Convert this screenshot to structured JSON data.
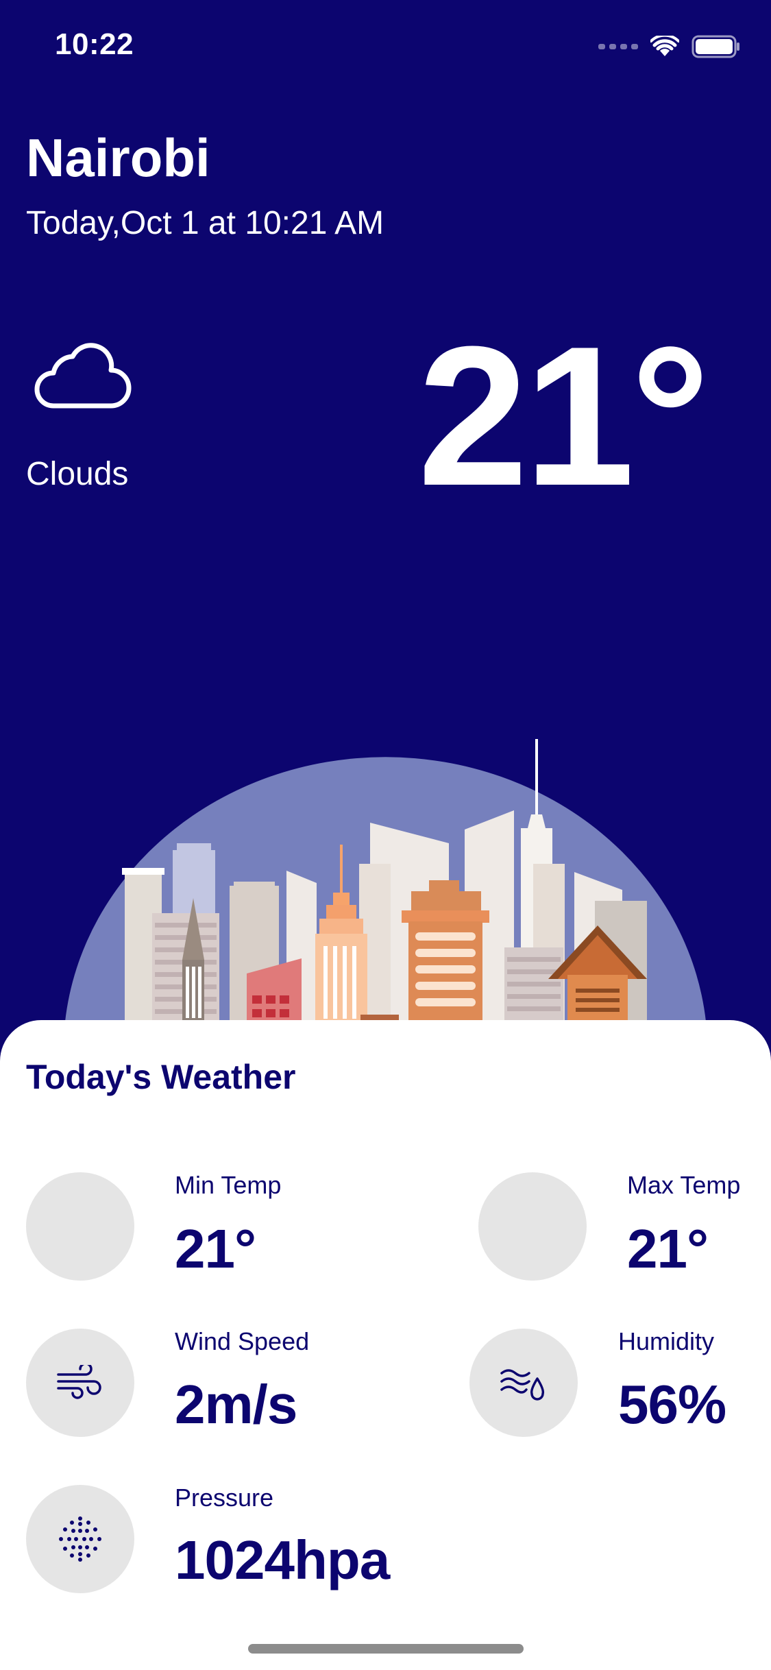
{
  "status_bar": {
    "time": "10:22",
    "wifi_icon": "wifi-icon",
    "battery_icon": "battery-icon"
  },
  "header": {
    "city": "Nairobi",
    "datetime": "Today,Oct 1 at 10:21 AM"
  },
  "current": {
    "icon": "cloud-icon",
    "condition": "Clouds",
    "temperature": "21°"
  },
  "todays_weather": {
    "title": "Today's Weather",
    "metrics": {
      "min_temp": {
        "label": "Min Temp",
        "value": "21°"
      },
      "max_temp": {
        "label": "Max Temp",
        "value": "21°"
      },
      "wind_speed": {
        "label": "Wind Speed",
        "value": "2m/s",
        "icon": "wind-icon"
      },
      "humidity": {
        "label": "Humidity",
        "value": "56%",
        "icon": "humidity-icon"
      },
      "pressure": {
        "label": "Pressure",
        "value": "1024hpa",
        "icon": "pressure-icon"
      }
    }
  },
  "colors": {
    "background": "#0c056f",
    "sheet": "#ffffff",
    "accent_text": "#0c056f",
    "icon_circle": "#e5e5e5",
    "skyline_dome": "#7680bd"
  }
}
